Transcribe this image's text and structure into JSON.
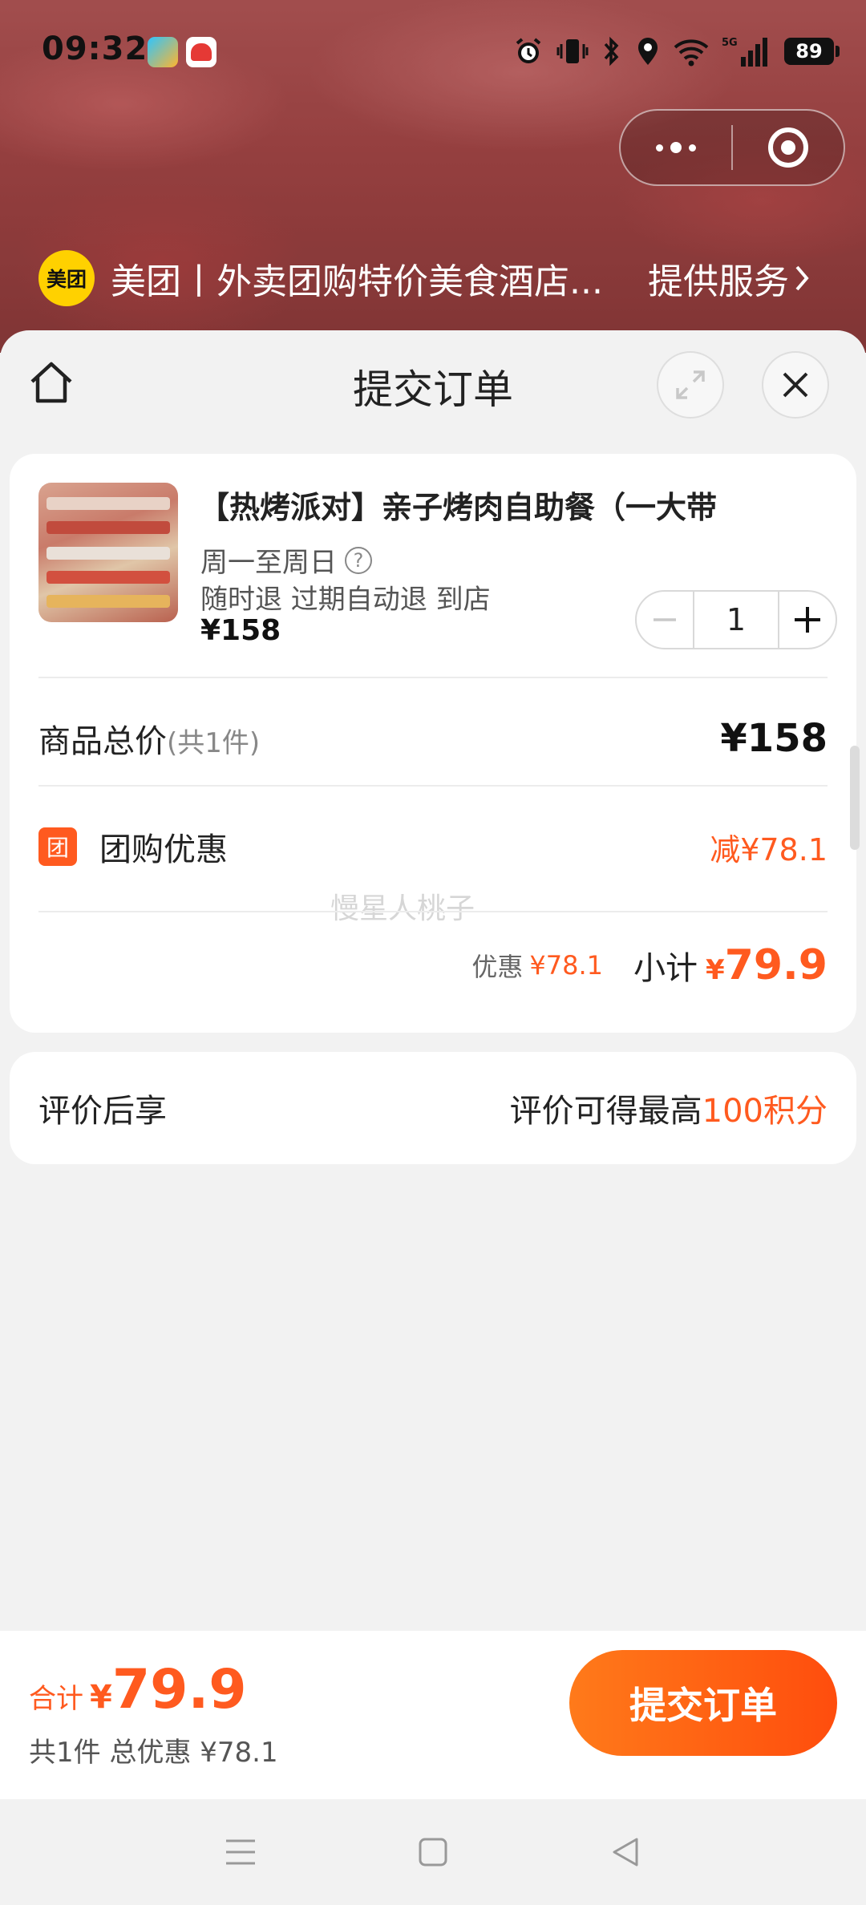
{
  "status_bar": {
    "time": "09:32",
    "battery": "89",
    "icons": [
      "alarm-icon",
      "vibrate-icon",
      "bluetooth-icon",
      "location-icon",
      "wifi-icon",
      "signal-5g-icon"
    ]
  },
  "provider": {
    "logo_text": "美团",
    "name": "美团丨外卖团购特价美食酒店...",
    "service_label": "提供服务"
  },
  "sheet": {
    "title": "提交订单"
  },
  "order": {
    "product": {
      "title": "【热烤派对】亲子烤肉自助餐（一大带",
      "days": "周一至周日",
      "tags": "随时退 过期自动退 到店",
      "price": "¥158",
      "quantity": "1"
    },
    "total": {
      "label": "商品总价",
      "count": "(共1件)",
      "value": "¥158"
    },
    "discount": {
      "badge": "团",
      "label": "团购优惠",
      "value": "减¥78.1"
    },
    "watermark": "慢星人桃子",
    "subtotal": {
      "discount_label": "优惠",
      "discount_value": "¥78.1",
      "label": "小计",
      "currency": "¥",
      "value": "79.9"
    }
  },
  "reward": {
    "label": "评价后享",
    "desc_prefix": "评价可得最高",
    "desc_highlight": "100积分"
  },
  "footer": {
    "sum_label": "合计",
    "sum_currency": "¥",
    "sum_value": "79.9",
    "summary": "共1件 总优惠 ¥78.1",
    "submit_label": "提交订单"
  },
  "colors": {
    "accent": "#ff5a1f",
    "meituan_yellow": "#ffd100"
  }
}
